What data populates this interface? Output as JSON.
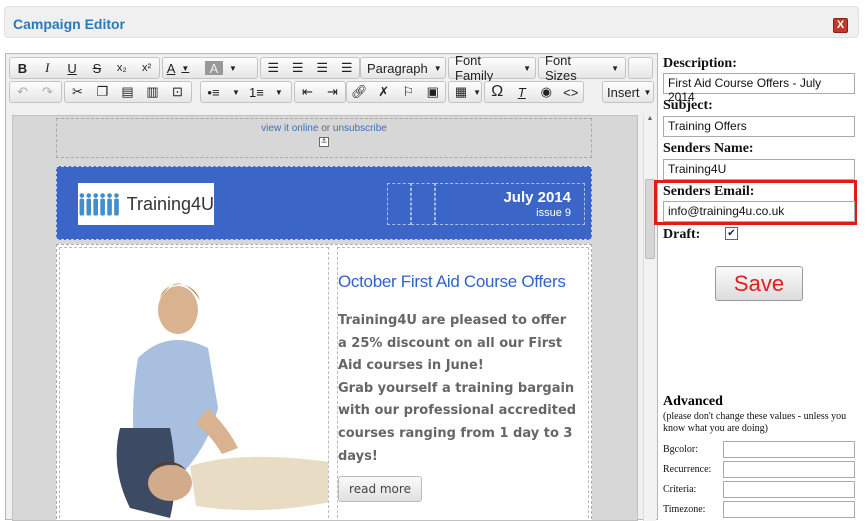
{
  "window": {
    "title": "Campaign Editor",
    "close": "X"
  },
  "toolbar": {
    "row1": {
      "bold": "B",
      "italic": "I",
      "underline": "U",
      "strike": "S",
      "subscript": "x₂",
      "superscript": "x²",
      "text_color": "A",
      "bg_color": "A",
      "format_select": "Paragraph",
      "font_family": "Font Family",
      "font_size": "Font Sizes"
    },
    "row2": {
      "insert_menu": "Insert",
      "omega": "Ω"
    }
  },
  "email": {
    "view_online": "view it online",
    "or": "or",
    "unsubscribe": "unsubscribe",
    "logo_text": "Training4U",
    "header_date": "July 2014",
    "header_issue": "issue 9",
    "heading": "October First Aid Course Offers",
    "paragraph1": "Training4U are pleased to offer a 25% discount on all our First Aid courses in June!",
    "paragraph2": "Grab yourself a training bargain with our professional accredited courses ranging from 1 day to 3 days!",
    "read_more": "read more"
  },
  "form": {
    "description_label": "Description:",
    "description_value": "First Aid Course Offers - July 2014",
    "subject_label": "Subject:",
    "subject_value": "Training Offers",
    "sender_name_label": "Senders Name:",
    "sender_name_value": "Training4U",
    "sender_email_label": "Senders Email:",
    "sender_email_value": "info@training4u.co.uk",
    "draft_label": "Draft:",
    "draft_checked": true,
    "save_label": "Save",
    "advanced_title": "Advanced",
    "advanced_note": "(please don't change these values - unless you know what you are doing)",
    "bgcolor_label": "Bgcolor:",
    "recurrence_label": "Recurrence:",
    "criteria_label": "Criteria:",
    "timezone_label": "Timezone:"
  },
  "colors": {
    "accent": "#2a7ab8",
    "header_blue": "#3b66c7",
    "highlight": "#e41a1a",
    "save_text": "#e21d1d"
  }
}
